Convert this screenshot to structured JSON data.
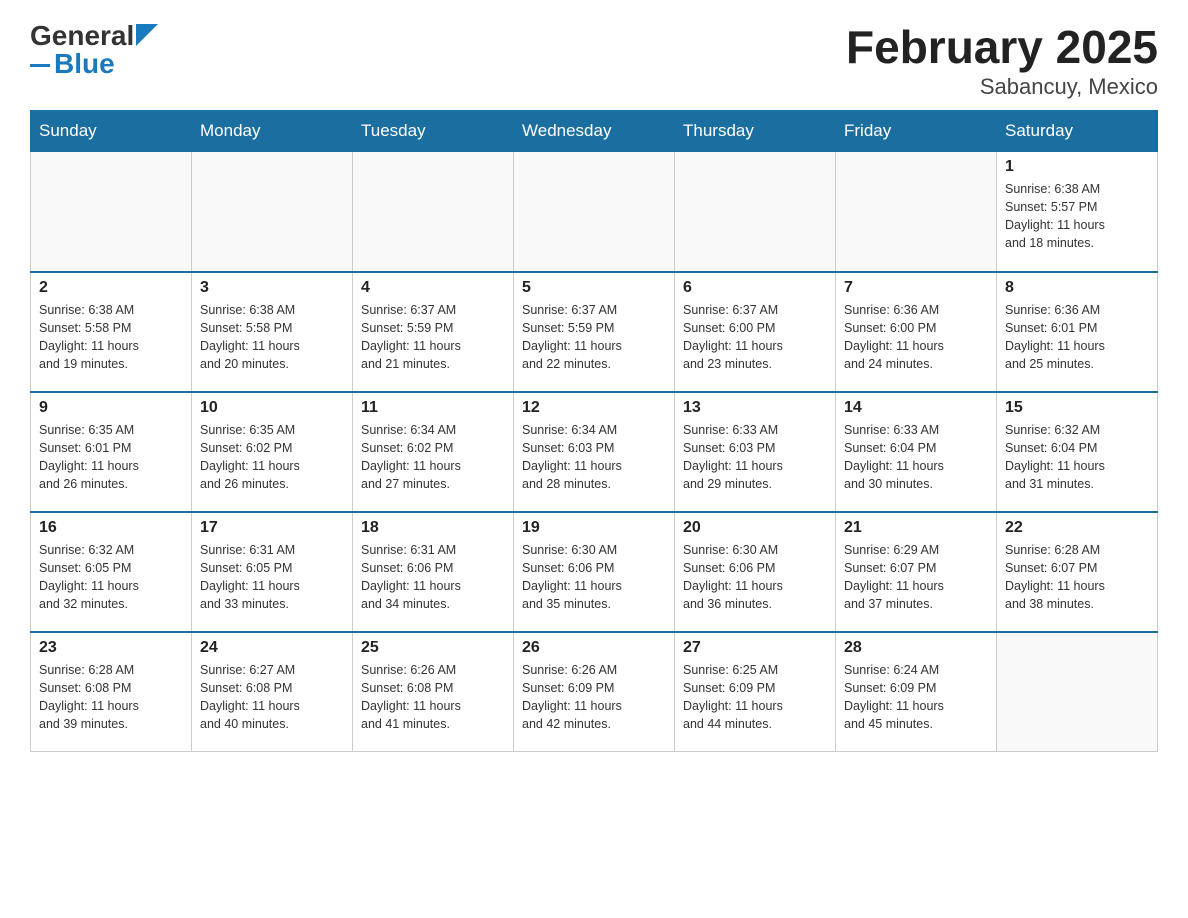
{
  "header": {
    "logo_general": "General",
    "logo_blue": "Blue",
    "month_title": "February 2025",
    "subtitle": "Sabancuy, Mexico"
  },
  "days_of_week": [
    "Sunday",
    "Monday",
    "Tuesday",
    "Wednesday",
    "Thursday",
    "Friday",
    "Saturday"
  ],
  "weeks": [
    {
      "days": [
        {
          "number": "",
          "info": ""
        },
        {
          "number": "",
          "info": ""
        },
        {
          "number": "",
          "info": ""
        },
        {
          "number": "",
          "info": ""
        },
        {
          "number": "",
          "info": ""
        },
        {
          "number": "",
          "info": ""
        },
        {
          "number": "1",
          "info": "Sunrise: 6:38 AM\nSunset: 5:57 PM\nDaylight: 11 hours\nand 18 minutes."
        }
      ]
    },
    {
      "days": [
        {
          "number": "2",
          "info": "Sunrise: 6:38 AM\nSunset: 5:58 PM\nDaylight: 11 hours\nand 19 minutes."
        },
        {
          "number": "3",
          "info": "Sunrise: 6:38 AM\nSunset: 5:58 PM\nDaylight: 11 hours\nand 20 minutes."
        },
        {
          "number": "4",
          "info": "Sunrise: 6:37 AM\nSunset: 5:59 PM\nDaylight: 11 hours\nand 21 minutes."
        },
        {
          "number": "5",
          "info": "Sunrise: 6:37 AM\nSunset: 5:59 PM\nDaylight: 11 hours\nand 22 minutes."
        },
        {
          "number": "6",
          "info": "Sunrise: 6:37 AM\nSunset: 6:00 PM\nDaylight: 11 hours\nand 23 minutes."
        },
        {
          "number": "7",
          "info": "Sunrise: 6:36 AM\nSunset: 6:00 PM\nDaylight: 11 hours\nand 24 minutes."
        },
        {
          "number": "8",
          "info": "Sunrise: 6:36 AM\nSunset: 6:01 PM\nDaylight: 11 hours\nand 25 minutes."
        }
      ]
    },
    {
      "days": [
        {
          "number": "9",
          "info": "Sunrise: 6:35 AM\nSunset: 6:01 PM\nDaylight: 11 hours\nand 26 minutes."
        },
        {
          "number": "10",
          "info": "Sunrise: 6:35 AM\nSunset: 6:02 PM\nDaylight: 11 hours\nand 26 minutes."
        },
        {
          "number": "11",
          "info": "Sunrise: 6:34 AM\nSunset: 6:02 PM\nDaylight: 11 hours\nand 27 minutes."
        },
        {
          "number": "12",
          "info": "Sunrise: 6:34 AM\nSunset: 6:03 PM\nDaylight: 11 hours\nand 28 minutes."
        },
        {
          "number": "13",
          "info": "Sunrise: 6:33 AM\nSunset: 6:03 PM\nDaylight: 11 hours\nand 29 minutes."
        },
        {
          "number": "14",
          "info": "Sunrise: 6:33 AM\nSunset: 6:04 PM\nDaylight: 11 hours\nand 30 minutes."
        },
        {
          "number": "15",
          "info": "Sunrise: 6:32 AM\nSunset: 6:04 PM\nDaylight: 11 hours\nand 31 minutes."
        }
      ]
    },
    {
      "days": [
        {
          "number": "16",
          "info": "Sunrise: 6:32 AM\nSunset: 6:05 PM\nDaylight: 11 hours\nand 32 minutes."
        },
        {
          "number": "17",
          "info": "Sunrise: 6:31 AM\nSunset: 6:05 PM\nDaylight: 11 hours\nand 33 minutes."
        },
        {
          "number": "18",
          "info": "Sunrise: 6:31 AM\nSunset: 6:06 PM\nDaylight: 11 hours\nand 34 minutes."
        },
        {
          "number": "19",
          "info": "Sunrise: 6:30 AM\nSunset: 6:06 PM\nDaylight: 11 hours\nand 35 minutes."
        },
        {
          "number": "20",
          "info": "Sunrise: 6:30 AM\nSunset: 6:06 PM\nDaylight: 11 hours\nand 36 minutes."
        },
        {
          "number": "21",
          "info": "Sunrise: 6:29 AM\nSunset: 6:07 PM\nDaylight: 11 hours\nand 37 minutes."
        },
        {
          "number": "22",
          "info": "Sunrise: 6:28 AM\nSunset: 6:07 PM\nDaylight: 11 hours\nand 38 minutes."
        }
      ]
    },
    {
      "days": [
        {
          "number": "23",
          "info": "Sunrise: 6:28 AM\nSunset: 6:08 PM\nDaylight: 11 hours\nand 39 minutes."
        },
        {
          "number": "24",
          "info": "Sunrise: 6:27 AM\nSunset: 6:08 PM\nDaylight: 11 hours\nand 40 minutes."
        },
        {
          "number": "25",
          "info": "Sunrise: 6:26 AM\nSunset: 6:08 PM\nDaylight: 11 hours\nand 41 minutes."
        },
        {
          "number": "26",
          "info": "Sunrise: 6:26 AM\nSunset: 6:09 PM\nDaylight: 11 hours\nand 42 minutes."
        },
        {
          "number": "27",
          "info": "Sunrise: 6:25 AM\nSunset: 6:09 PM\nDaylight: 11 hours\nand 44 minutes."
        },
        {
          "number": "28",
          "info": "Sunrise: 6:24 AM\nSunset: 6:09 PM\nDaylight: 11 hours\nand 45 minutes."
        },
        {
          "number": "",
          "info": ""
        }
      ]
    }
  ]
}
